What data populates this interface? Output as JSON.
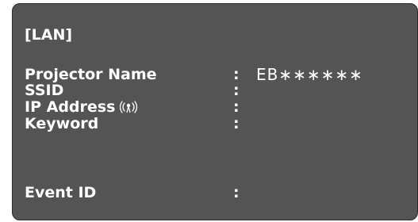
{
  "screen": {
    "title": "[LAN]"
  },
  "fields": [
    {
      "label": "Projector Name",
      "separator": ":",
      "value": "EB∗∗∗∗∗∗"
    },
    {
      "label": "SSID",
      "separator": ":",
      "value": ""
    },
    {
      "label": "IP Address",
      "separator": ":",
      "value": "",
      "icon": "wireless-signal-icon"
    },
    {
      "label": "Keyword",
      "separator": ":",
      "value": ""
    },
    {
      "label": "Event ID",
      "separator": ":",
      "value": ""
    }
  ],
  "colors": {
    "panel_background": "#545454",
    "panel_border": "#2a2a2a",
    "text": "#ffffff",
    "page_background": "#ffffff"
  }
}
